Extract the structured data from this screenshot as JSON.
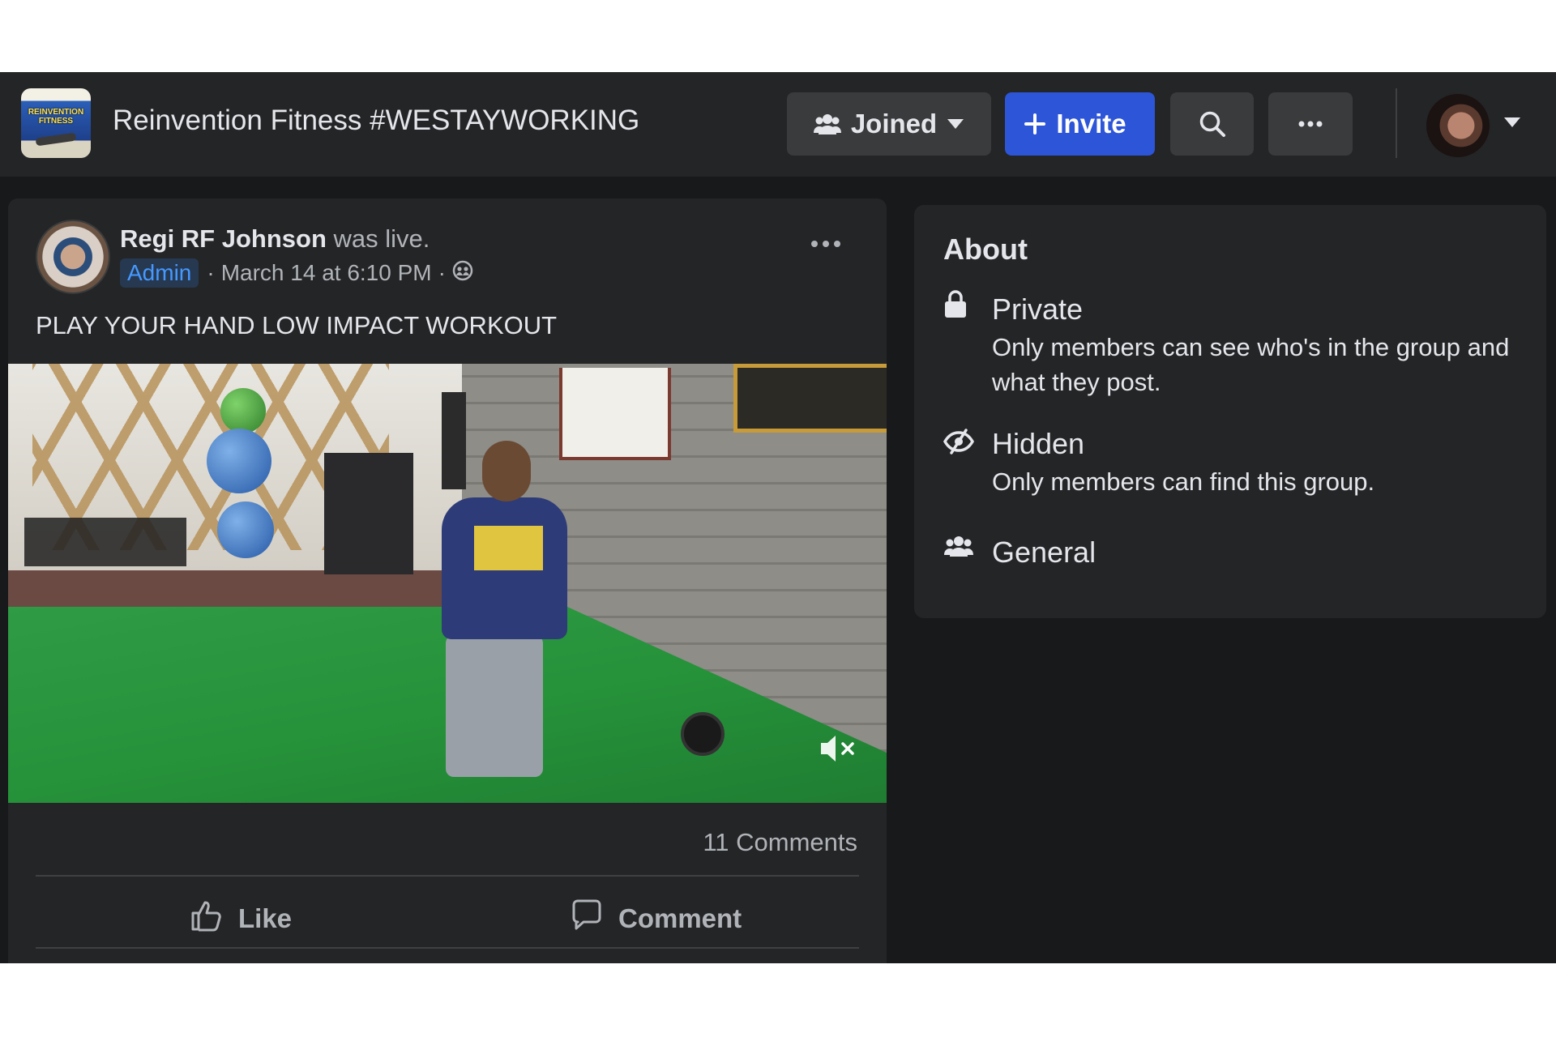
{
  "header": {
    "group_title": "Reinvention Fitness #WESTAYWORKING",
    "logo_text": "REINVENTION FITNESS",
    "joined_label": "Joined",
    "invite_label": "Invite"
  },
  "post": {
    "author_name": "Regi RF Johnson",
    "author_action": "was live.",
    "role_badge": "Admin",
    "timestamp": "March 14 at 6:10 PM",
    "separator": "·",
    "text": "PLAY YOUR HAND LOW IMPACT WORKOUT",
    "comments_count": "11 Comments",
    "like_label": "Like",
    "comment_label": "Comment"
  },
  "about": {
    "title": "About",
    "items": [
      {
        "icon": "lock-icon",
        "heading": "Private",
        "description": "Only members can see who's in the group and what they post."
      },
      {
        "icon": "hidden-eye-icon",
        "heading": "Hidden",
        "description": "Only members can find this group."
      },
      {
        "icon": "people-icon",
        "heading": "General",
        "description": ""
      }
    ]
  },
  "colors": {
    "page_bg": "#18191a",
    "card_bg": "#242526",
    "accent_blue": "#2d55d8",
    "admin_badge_text": "#4599ff",
    "primary_text": "#e4e6eb",
    "secondary_text": "#b0b3b8"
  }
}
